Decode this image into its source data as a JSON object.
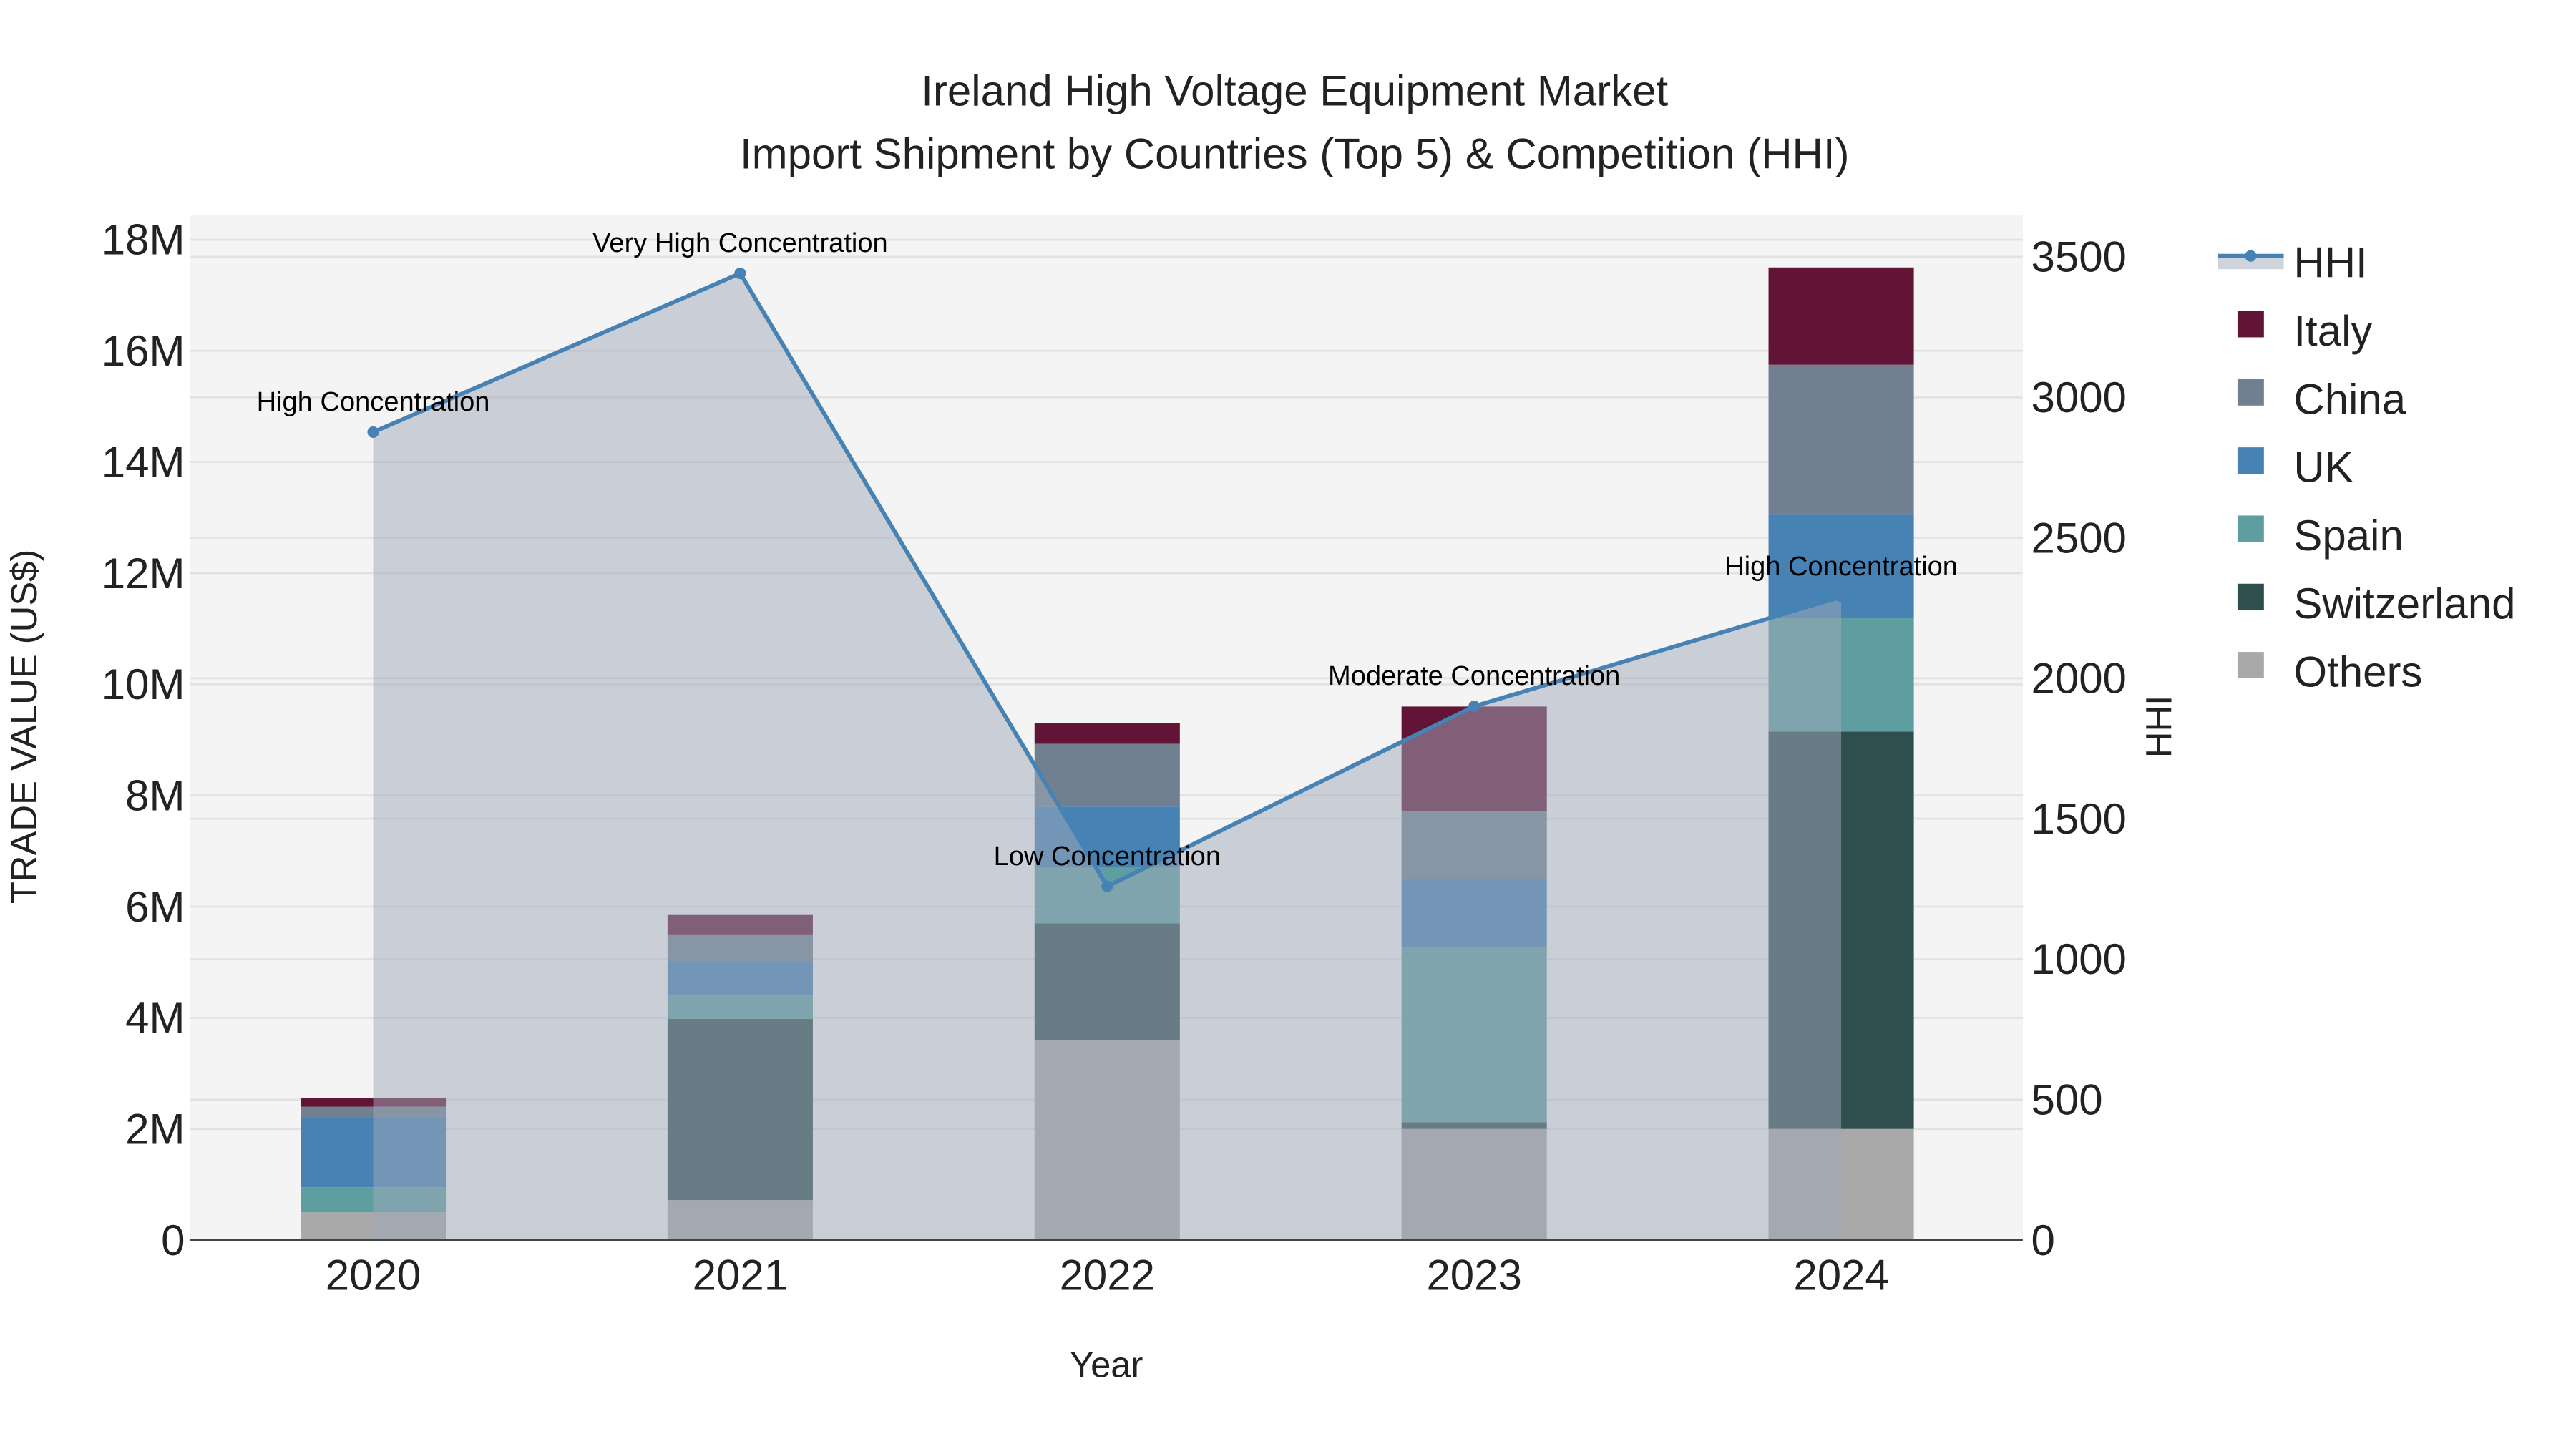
{
  "chart_data": {
    "type": "bar",
    "title": "Ireland High Voltage Equipment Market",
    "subtitle": "Import Shipment by Countries (Top 5) & Competition (HHI)",
    "xlabel": "Year",
    "ylabel": "TRADE VALUE (US$)",
    "y2label": "HHI",
    "categories": [
      "2020",
      "2021",
      "2022",
      "2023",
      "2024"
    ],
    "ylim": [
      0,
      18450000
    ],
    "y2lim": [
      0,
      3650
    ],
    "yticks": [
      {
        "v": 0,
        "label": "0"
      },
      {
        "v": 2000000,
        "label": "2M"
      },
      {
        "v": 4000000,
        "label": "4M"
      },
      {
        "v": 6000000,
        "label": "6M"
      },
      {
        "v": 8000000,
        "label": "8M"
      },
      {
        "v": 10000000,
        "label": "10M"
      },
      {
        "v": 12000000,
        "label": "12M"
      },
      {
        "v": 14000000,
        "label": "14M"
      },
      {
        "v": 16000000,
        "label": "16M"
      },
      {
        "v": 18000000,
        "label": "18M"
      }
    ],
    "y2ticks": [
      {
        "v": 0,
        "label": "0"
      },
      {
        "v": 500,
        "label": "500"
      },
      {
        "v": 1000,
        "label": "1000"
      },
      {
        "v": 1500,
        "label": "1500"
      },
      {
        "v": 2000,
        "label": "2000"
      },
      {
        "v": 2500,
        "label": "2500"
      },
      {
        "v": 3000,
        "label": "3000"
      },
      {
        "v": 3500,
        "label": "3500"
      }
    ],
    "stack_order": [
      "Others",
      "Switzerland",
      "Spain",
      "UK",
      "China",
      "Italy"
    ],
    "series": [
      {
        "name": "Others",
        "color": "#a9a9a9",
        "values": [
          500000,
          720000,
          3600000,
          2000000,
          2000000
        ]
      },
      {
        "name": "Switzerland",
        "color": "#2f4f4f",
        "values": [
          0,
          3260000,
          2100000,
          120000,
          7150000
        ]
      },
      {
        "name": "Spain",
        "color": "#5f9ea0",
        "values": [
          450000,
          420000,
          1000000,
          3160000,
          2050000
        ]
      },
      {
        "name": "UK",
        "color": "#4682b4",
        "values": [
          1250000,
          600000,
          1100000,
          1220000,
          1850000
        ]
      },
      {
        "name": "China",
        "color": "#708090",
        "values": [
          200000,
          500000,
          1130000,
          1220000,
          2700000
        ]
      },
      {
        "name": "Italy",
        "color": "#621436",
        "values": [
          150000,
          350000,
          370000,
          1880000,
          1750000
        ]
      }
    ],
    "hhi": {
      "name": "HHI",
      "color": "#4682b4",
      "values": [
        2876,
        3441,
        1259,
        1900,
        2290
      ],
      "annotations": [
        "High Concentration",
        "Very High Concentration",
        "Low Concentration",
        "Moderate Concentration",
        "High Concentration"
      ]
    },
    "legend": {
      "placement": "right",
      "order": [
        "HHI",
        "Italy",
        "China",
        "UK",
        "Spain",
        "Switzerland",
        "Others"
      ]
    },
    "grid": true
  }
}
